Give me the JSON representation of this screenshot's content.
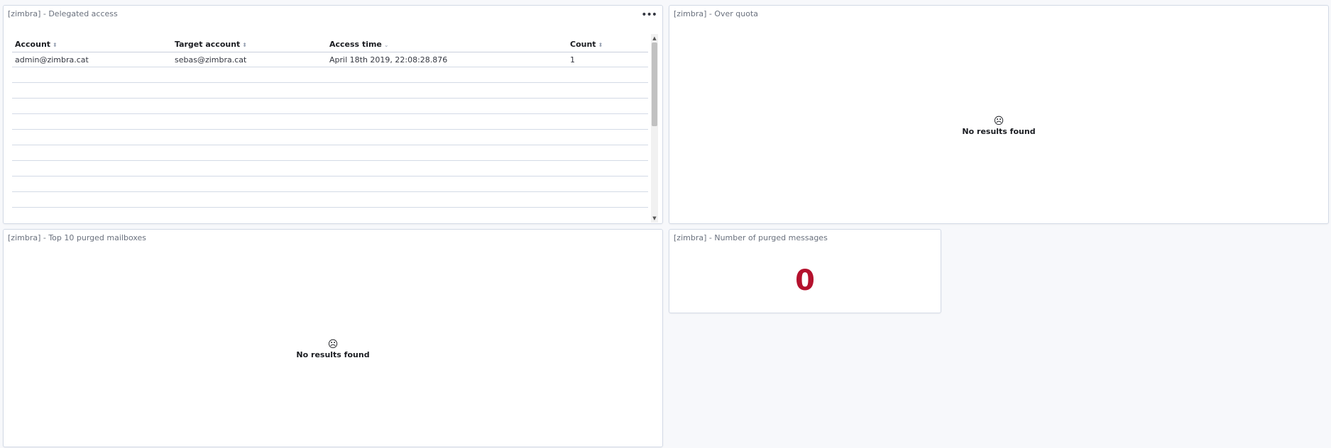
{
  "panels": {
    "delegated": {
      "title": "[zimbra] - Delegated access",
      "menu_icon": "ellipsis-icon",
      "columns": [
        "Account",
        "Target account",
        "Access time",
        "Count"
      ],
      "sort_icons": [
        "⬍",
        "⬍",
        "⌄",
        "⬍"
      ],
      "rows": [
        [
          "admin@zimbra.cat",
          "sebas@zimbra.cat",
          "April 18th 2019, 22:08:28.876",
          "1"
        ]
      ]
    },
    "over_quota": {
      "title": "[zimbra] - Over quota",
      "empty_icon": "☹",
      "empty_message": "No results found"
    },
    "top_purged": {
      "title": "[zimbra] - Top 10 purged mailboxes",
      "empty_icon": "☹",
      "empty_message": "No results found"
    },
    "purged_count": {
      "title": "[zimbra] - Number of purged messages",
      "value": "0",
      "value_color": "#b4112d"
    }
  }
}
